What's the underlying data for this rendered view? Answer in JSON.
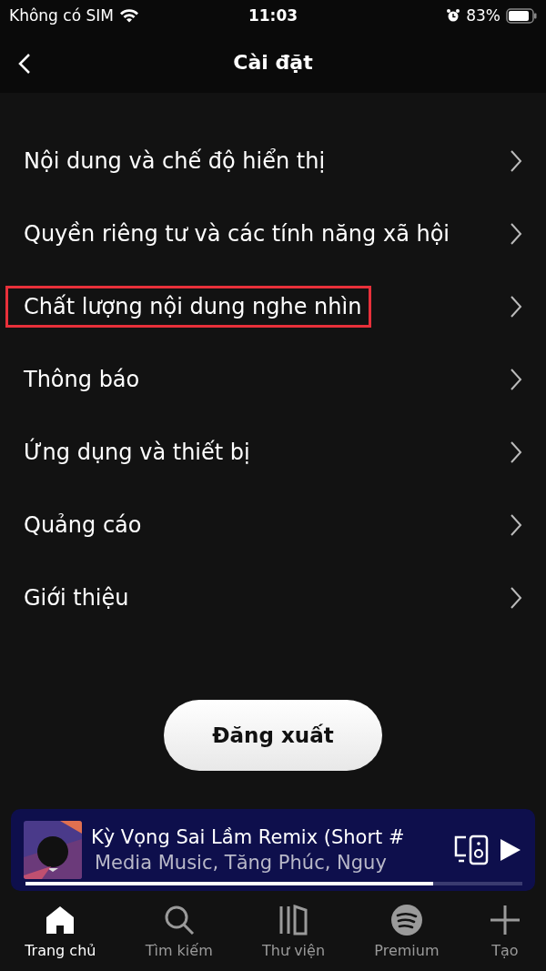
{
  "status_bar": {
    "carrier": "Không có SIM",
    "time": "11:03",
    "battery": "83%"
  },
  "header": {
    "title": "Cài đặt"
  },
  "settings": [
    {
      "label": "Nội dung và chế độ hiển thị",
      "highlighted": false
    },
    {
      "label": "Quyền riêng tư và các tính năng xã hội",
      "highlighted": false
    },
    {
      "label": "Chất lượng nội dung nghe nhìn",
      "highlighted": true
    },
    {
      "label": "Thông báo",
      "highlighted": false
    },
    {
      "label": "Ứng dụng và thiết bị",
      "highlighted": false
    },
    {
      "label": "Quảng cáo",
      "highlighted": false
    },
    {
      "label": "Giới thiệu",
      "highlighted": false
    }
  ],
  "logout_button": "Đăng xuất",
  "now_playing": {
    "title": "Kỳ Vọng Sai Lầm Remix (Short #",
    "artists": "Media Music, Tăng Phúc, Nguy",
    "level": 0.82,
    "playing": false
  },
  "tabs": [
    {
      "kind": "home",
      "label": "Trang chủ",
      "selected": true
    },
    {
      "kind": "search",
      "label": "Tìm kiếm",
      "selected": false
    },
    {
      "kind": "library",
      "label": "Thư viện",
      "selected": false
    },
    {
      "kind": "premium",
      "label": "Premium",
      "selected": false
    },
    {
      "kind": "create",
      "label": "Tạo",
      "selected": false
    }
  ]
}
